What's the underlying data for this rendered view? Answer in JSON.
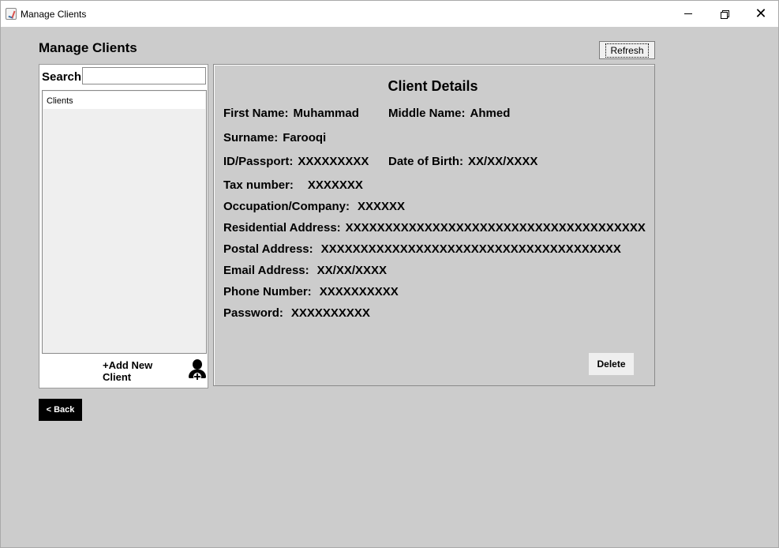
{
  "window": {
    "title": "Manage Clients"
  },
  "page": {
    "title": "Manage Clients"
  },
  "toolbar": {
    "refresh_label": "Refresh"
  },
  "search": {
    "label": "Search",
    "value": "",
    "placeholder": ""
  },
  "clients_list": {
    "header": "Clients",
    "items": []
  },
  "add_client": {
    "label": "+Add New Client"
  },
  "details": {
    "title": "Client Details",
    "first_name": {
      "label": "First Name:",
      "value": "Muhammad"
    },
    "middle_name": {
      "label": "Middle Name:",
      "value": "Ahmed"
    },
    "surname": {
      "label": "Surname:",
      "value": "Farooqi"
    },
    "id_passport": {
      "label": "ID/Passport:",
      "value": "XXXXXXXXX"
    },
    "date_of_birth": {
      "label": "Date of Birth:",
      "value": "XX/XX/XXXX"
    },
    "tax_number": {
      "label": "Tax number:",
      "value": "XXXXXXX"
    },
    "occupation": {
      "label": "Occupation/Company:",
      "value": "XXXXXX"
    },
    "residential_address": {
      "label": "Residential Address:",
      "value": "XXXXXXXXXXXXXXXXXXXXXXXXXXXXXXXXXXXXXX"
    },
    "postal_address": {
      "label": "Postal Address:",
      "value": "XXXXXXXXXXXXXXXXXXXXXXXXXXXXXXXXXXXXXX"
    },
    "email_address": {
      "label": "Email Address:",
      "value": "XX/XX/XXXX"
    },
    "phone_number": {
      "label": "Phone Number:",
      "value": "XXXXXXXXXX"
    },
    "password": {
      "label": "Password:",
      "value": "XXXXXXXXXX"
    },
    "delete_label": "Delete"
  },
  "navigation": {
    "back_label": "< Back"
  },
  "icons": {
    "app": "java-app-icon",
    "add_client": "user-add-icon",
    "minimize": "minimize-icon",
    "maximize": "restore-icon",
    "close": "close-icon"
  },
  "colors": {
    "background": "#cccccc",
    "panel": "#ffffff",
    "back_button": "#000000"
  }
}
